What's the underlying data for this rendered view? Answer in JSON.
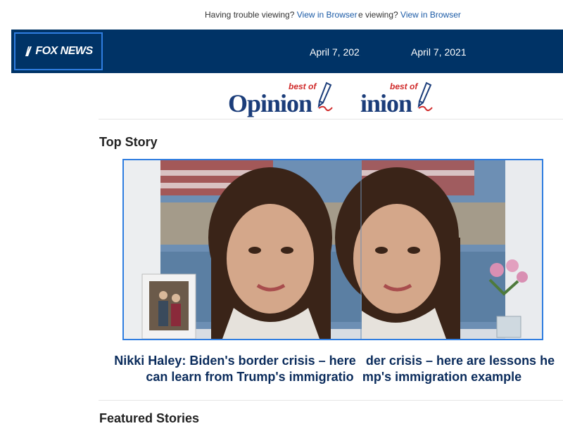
{
  "trouble": {
    "prefix": "Having trouble viewing?",
    "link": "View in Browser",
    "prefix_tail": "e viewing?"
  },
  "header": {
    "logo_text": "FOX NEWS",
    "date": "April 7, 2021",
    "date_clipped": "April 7, 2021"
  },
  "banner": {
    "best_of": "best of",
    "word": "Opinion",
    "word_clipped": "inion"
  },
  "top_story": {
    "section_title": "Top Story",
    "image_alt": "Nikki Haley on video call",
    "headline_line1_left": "Nikki Haley: Biden's border crisis – here",
    "headline_line1_right": "der crisis – here are lessons he",
    "headline_line2_left": "can learn from Trump's immigratio",
    "headline_line2_right": "mp's immigration example"
  },
  "featured": {
    "section_title": "Featured Stories"
  },
  "colors": {
    "header_bg": "#003366",
    "link": "#1a5aa6",
    "headline": "#0b2c5c",
    "accent_border": "#2f7de0",
    "opinion_blue": "#1b3d7a",
    "opinion_red": "#d02a2a"
  },
  "icons": [
    "fox-news-logo-icon",
    "pen-icon"
  ]
}
